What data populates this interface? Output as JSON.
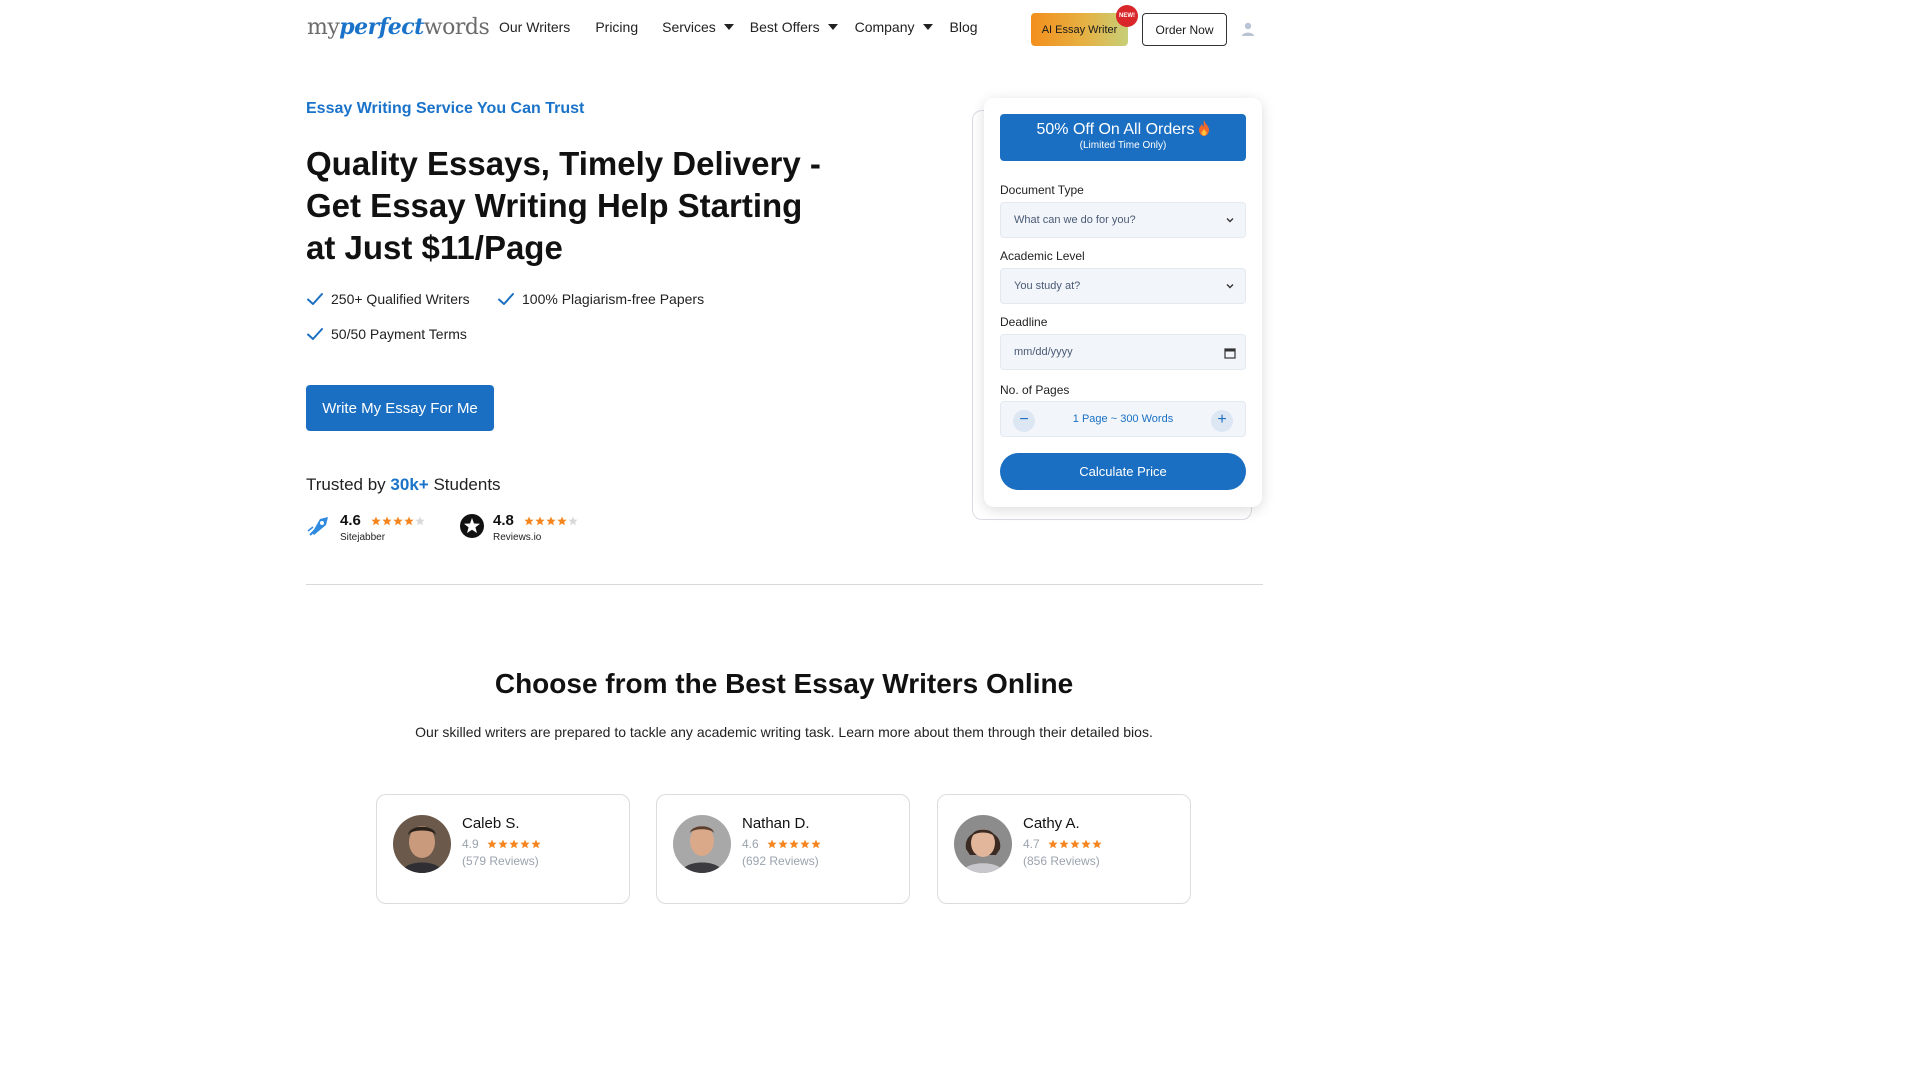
{
  "header": {
    "logo": {
      "part1": "my",
      "part2": "perfect",
      "part3": "words"
    },
    "nav": [
      {
        "label": "Our Writers",
        "dropdown": false
      },
      {
        "label": "Pricing",
        "dropdown": false
      },
      {
        "label": "Services",
        "dropdown": true
      },
      {
        "label": "Best Offers",
        "dropdown": true
      },
      {
        "label": "Company",
        "dropdown": true
      },
      {
        "label": "Blog",
        "dropdown": false
      }
    ],
    "ai_button": "AI Essay Writer",
    "new_badge": "NEW!",
    "order_button": "Order Now",
    "user_icon": "user-icon"
  },
  "hero": {
    "eyebrow": "Essay Writing Service You Can Trust",
    "title": "Quality Essays, Timely Delivery - Get Essay Writing Help Starting at Just $11/Page",
    "features": [
      "250+ Qualified Writers",
      "100% Plagiarism-free Papers",
      "50/50 Payment Terms"
    ],
    "cta": "Write My Essay For Me",
    "trusted_prefix": "Trusted by",
    "trusted_highlight": "30k+",
    "trusted_suffix": "Students",
    "ratings": [
      {
        "score": "4.6",
        "name": "Sitejabber",
        "stars": 4,
        "icon": "sitejabber-icon"
      },
      {
        "score": "4.8",
        "name": "Reviews.io",
        "stars": 4,
        "icon": "reviews-io-icon"
      }
    ]
  },
  "calculator": {
    "promo_title": "50% Off On All Orders",
    "promo_sub": "(Limited Time Only)",
    "doc_type_label": "Document Type",
    "doc_type_placeholder": "What can we do for you?",
    "level_label": "Academic Level",
    "level_placeholder": "You study at?",
    "deadline_label": "Deadline",
    "deadline_placeholder": "mm/dd/yyyy",
    "pages_label": "No. of Pages",
    "pages_value": "1 Page ~ 300 Words",
    "minus": "−",
    "plus": "+",
    "calc_button": "Calculate Price"
  },
  "writers_section": {
    "title": "Choose from the Best Essay Writers Online",
    "subtitle": "Our skilled writers are prepared to tackle any academic writing task. Learn more about them through their detailed bios.",
    "writers": [
      {
        "name": "Caleb S.",
        "rating": "4.9",
        "reviews": "(579 Reviews)"
      },
      {
        "name": "Nathan D.",
        "rating": "4.6",
        "reviews": "(692 Reviews)"
      },
      {
        "name": "Cathy A.",
        "rating": "4.7",
        "reviews": "(856 Reviews)"
      }
    ]
  },
  "colors": {
    "brand_blue": "#1a6fc2",
    "star_orange": "#f5861f",
    "badge_red": "#d8262a"
  }
}
